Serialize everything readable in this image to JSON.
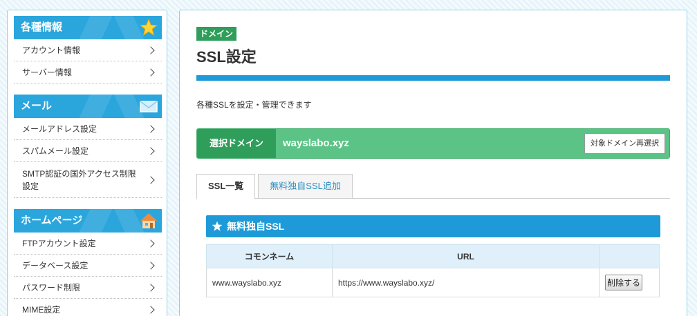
{
  "sidebar": {
    "sections": [
      {
        "title": "各種情報",
        "icon": "star-icon",
        "items": [
          "アカウント情報",
          "サーバー情報"
        ]
      },
      {
        "title": "メール",
        "icon": "mail-icon",
        "items": [
          "メールアドレス設定",
          "スパムメール設定",
          "SMTP認証の国外アクセス制限設定"
        ]
      },
      {
        "title": "ホームページ",
        "icon": "house-icon",
        "items": [
          "FTPアカウント設定",
          "データベース設定",
          "パスワード制限",
          "MIME設定"
        ]
      }
    ]
  },
  "main": {
    "tag": "ドメイン",
    "title": "SSL設定",
    "description": "各種SSLを設定・管理できます",
    "domain_bar": {
      "label": "選択ドメイン",
      "value": "wayslabo.xyz",
      "reselect_label": "対象ドメイン再選択"
    },
    "tabs": [
      {
        "label": "SSL一覧",
        "active": true
      },
      {
        "label": "無料独自SSL追加",
        "active": false
      }
    ],
    "section_title": "無料独自SSL",
    "table": {
      "headers": [
        "コモンネーム",
        "URL",
        ""
      ],
      "rows": [
        {
          "common_name": "www.wayslabo.xyz",
          "url": "https://www.wayslabo.xyz/",
          "action": "削除する"
        }
      ]
    }
  },
  "colors": {
    "accent_blue": "#1e9ad8",
    "accent_green": "#2e9e5a",
    "green_light": "#5bc386"
  }
}
